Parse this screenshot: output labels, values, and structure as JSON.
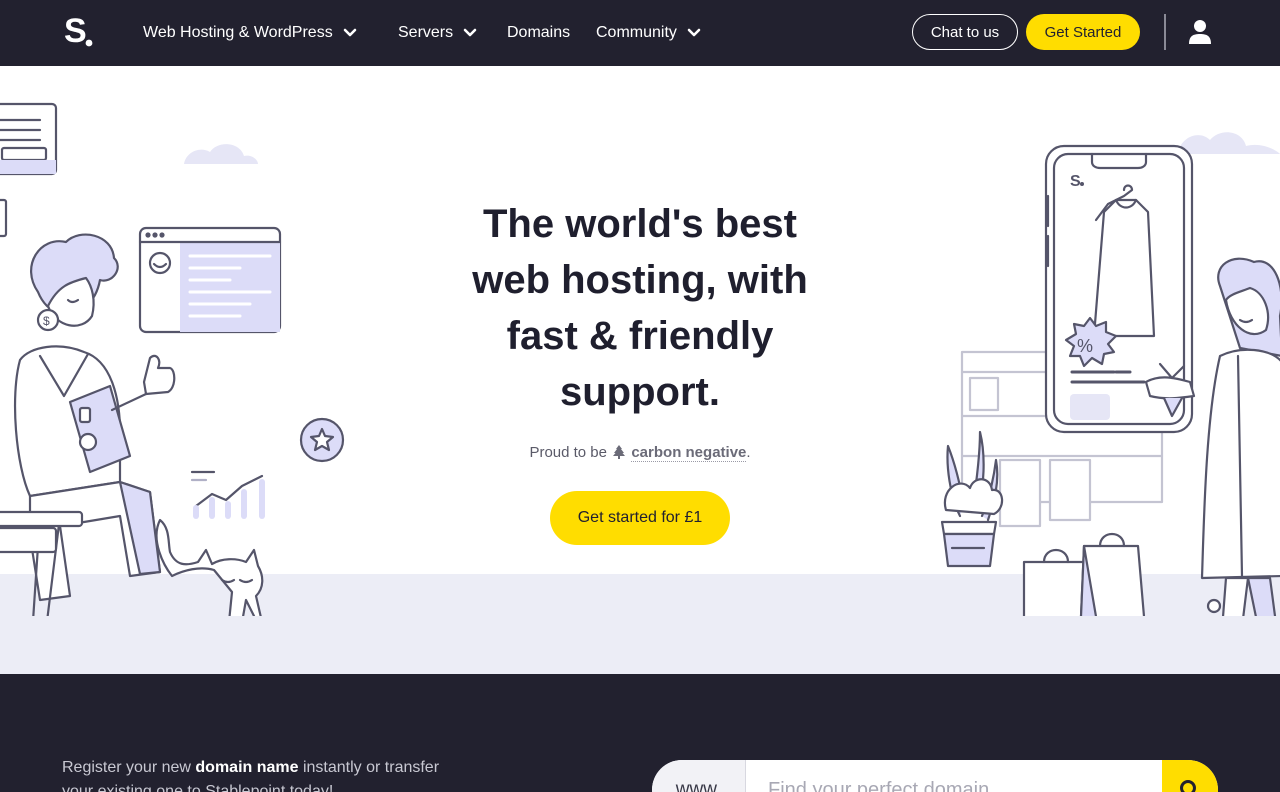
{
  "nav": {
    "items": [
      {
        "label": "Web Hosting & WordPress",
        "dropdown": true
      },
      {
        "label": "Servers",
        "dropdown": true
      },
      {
        "label": "Domains",
        "dropdown": false
      },
      {
        "label": "Community",
        "dropdown": true
      }
    ],
    "chat_label": "Chat to us",
    "start_label": "Get Started"
  },
  "hero": {
    "title_line1": "The world's best",
    "title_bold": "web hosting",
    "title_rest1": ", with",
    "title_line3": "fast & friendly",
    "title_line4": "support.",
    "sub_prefix": "Proud to be",
    "sub_link": "carbon negative",
    "sub_suffix": ".",
    "cta_label": "Get started for £1"
  },
  "domain": {
    "text_1": "Register your new ",
    "text_bold": "domain name",
    "text_2": " instantly or transfer your existing one to Stablepoint today!",
    "www_label": "www.",
    "search_placeholder": "Find your perfect domain..."
  },
  "colors": {
    "nav_bg": "#22212f",
    "accent_yellow": "#ffdd00",
    "lavender": "#dcdcf8",
    "floor": "#ecedf6"
  },
  "icons": {
    "logo": "stablepoint-s-logo",
    "chevron": "chevron-down-icon",
    "user": "user-icon",
    "tree": "tree-icon",
    "search": "search-icon"
  }
}
